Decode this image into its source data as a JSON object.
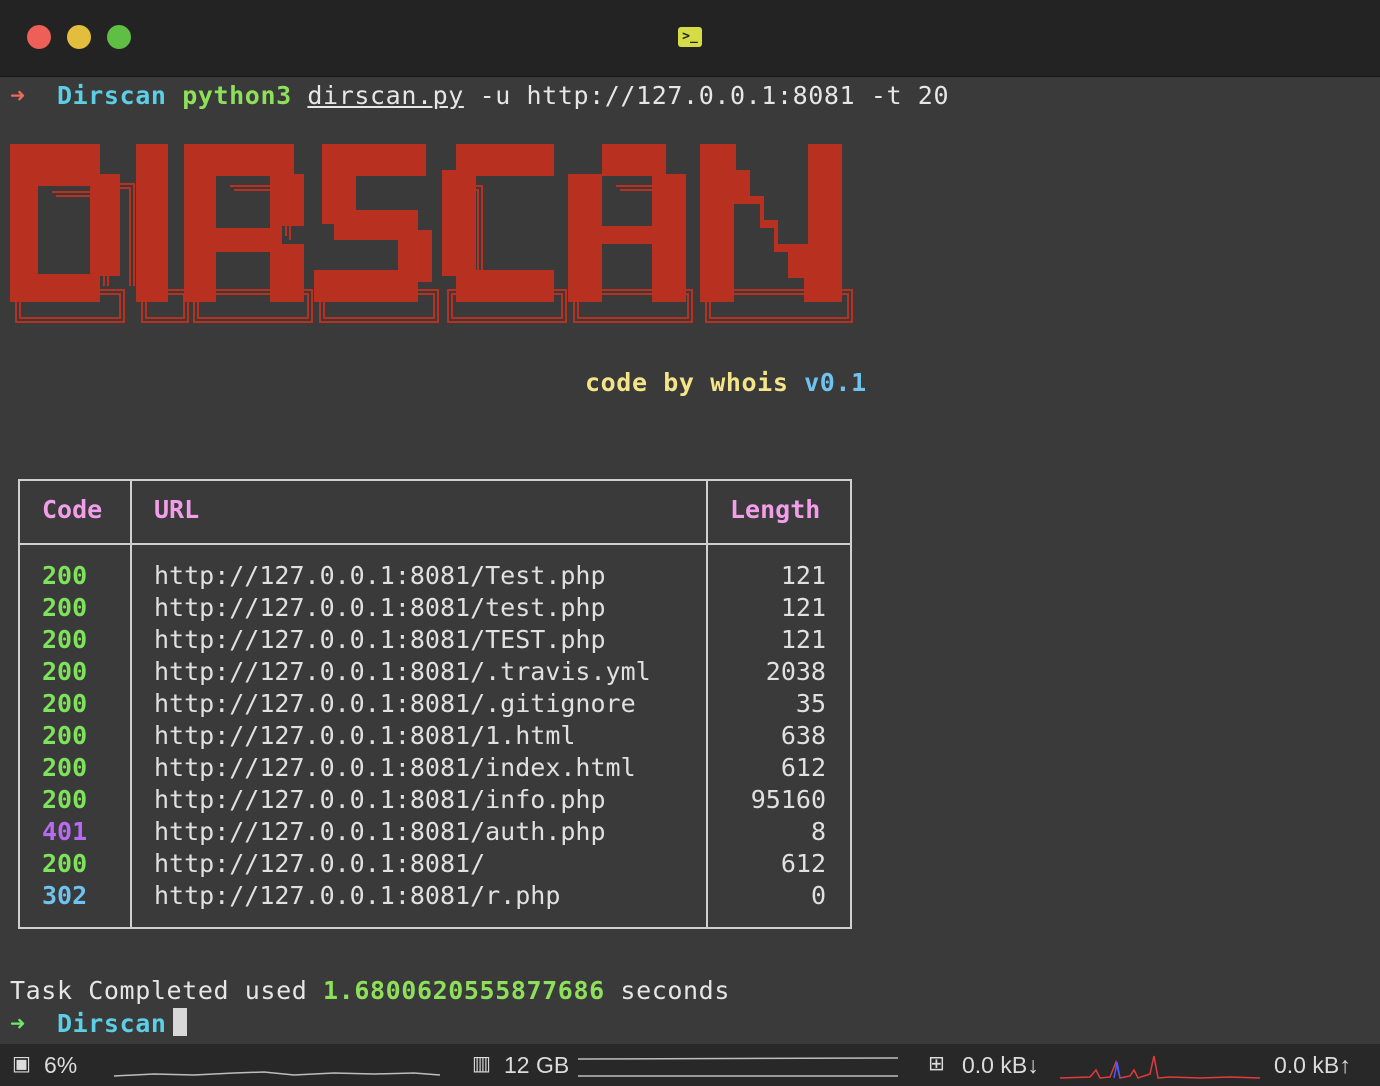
{
  "window": {
    "icon": "terminal-icon"
  },
  "prompt1": {
    "arrow": "➜",
    "directory": "Dirscan",
    "command": "python3",
    "script": "dirscan.py",
    "args": " -u http://127.0.0.1:8081 -t 20"
  },
  "banner": {
    "text": "DIRSCAN",
    "color": "#b8301f"
  },
  "credit": {
    "text": "code by whois",
    "version": "v0.1"
  },
  "table": {
    "headers": {
      "code": "Code",
      "url": "URL",
      "length": "Length"
    },
    "rows": [
      {
        "code": "200",
        "url": "http://127.0.0.1:8081/Test.php",
        "length": "121"
      },
      {
        "code": "200",
        "url": "http://127.0.0.1:8081/test.php",
        "length": "121"
      },
      {
        "code": "200",
        "url": "http://127.0.0.1:8081/TEST.php",
        "length": "121"
      },
      {
        "code": "200",
        "url": "http://127.0.0.1:8081/.travis.yml",
        "length": "2038"
      },
      {
        "code": "200",
        "url": "http://127.0.0.1:8081/.gitignore",
        "length": "35"
      },
      {
        "code": "200",
        "url": "http://127.0.0.1:8081/1.html",
        "length": "638"
      },
      {
        "code": "200",
        "url": "http://127.0.0.1:8081/index.html",
        "length": "612"
      },
      {
        "code": "200",
        "url": "http://127.0.0.1:8081/info.php",
        "length": "95160"
      },
      {
        "code": "401",
        "url": "http://127.0.0.1:8081/auth.php",
        "length": "8"
      },
      {
        "code": "200",
        "url": "http://127.0.0.1:8081/",
        "length": "612"
      },
      {
        "code": "302",
        "url": "http://127.0.0.1:8081/r.php",
        "length": "0"
      }
    ]
  },
  "completion": {
    "prefix": "Task Completed used",
    "seconds": "1.6800620555877686",
    "suffix": "seconds"
  },
  "prompt2": {
    "arrow": "➜",
    "directory": "Dirscan"
  },
  "statusbar": {
    "cpu": "6%",
    "memory": "12 GB",
    "net_down": "0.0 kB↓",
    "net_up": "0.0 kB↑",
    "cpu_icon": "cpu-icon",
    "memory_icon": "memory-icon",
    "network_icon": "network-icon"
  }
}
